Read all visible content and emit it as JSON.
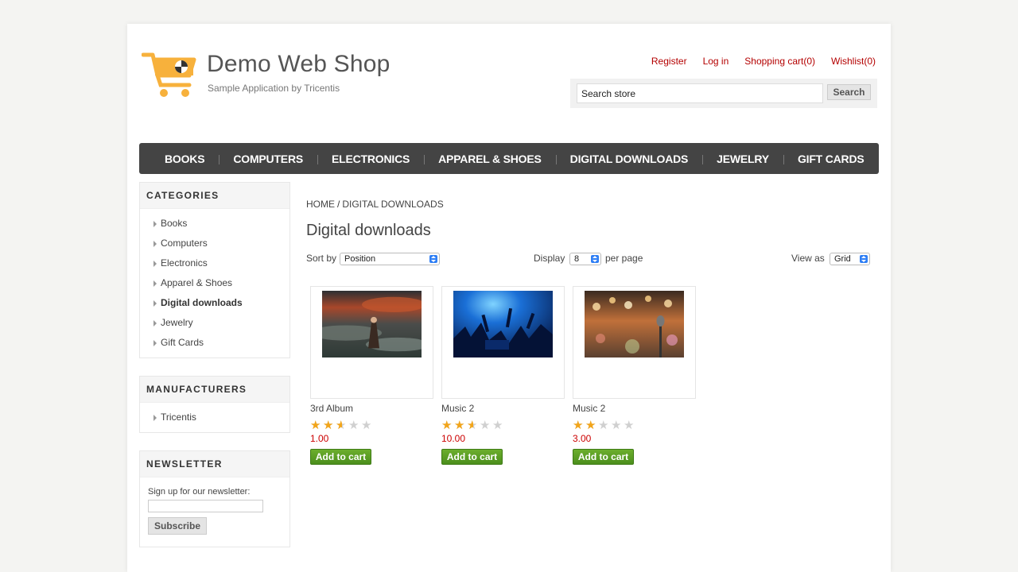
{
  "header": {
    "title": "Demo Web Shop",
    "subtitle": "Sample Application by Tricentis",
    "links": {
      "register": "Register",
      "login": "Log in",
      "cart": "Shopping cart(0)",
      "wishlist": "Wishlist(0)"
    },
    "search": {
      "value": "Search store",
      "button": "Search"
    }
  },
  "menu": [
    "BOOKS",
    "COMPUTERS",
    "ELECTRONICS",
    "APPAREL & SHOES",
    "DIGITAL DOWNLOADS",
    "JEWELRY",
    "GIFT CARDS"
  ],
  "categories": {
    "title": "CATEGORIES",
    "items": [
      "Books",
      "Computers",
      "Electronics",
      "Apparel & Shoes",
      "Digital downloads",
      "Jewelry",
      "Gift Cards"
    ],
    "active": "Digital downloads"
  },
  "manufacturers": {
    "title": "MANUFACTURERS",
    "items": [
      "Tricentis"
    ]
  },
  "newsletter": {
    "title": "NEWSLETTER",
    "label": "Sign up for our newsletter:",
    "button": "Subscribe"
  },
  "breadcrumb": {
    "home": "HOME",
    "separator": "/",
    "current": "DIGITAL DOWNLOADS"
  },
  "page_title": "Digital downloads",
  "controls": {
    "sort_label": "Sort by",
    "sort_value": "Position",
    "display_label": "Display",
    "display_value": "8",
    "per_page": "per page",
    "view_label": "View as",
    "view_value": "Grid"
  },
  "products": [
    {
      "name": "3rd Album",
      "rating": 2.5,
      "price": "1.00",
      "button": "Add to cart",
      "image": "album-cover-storm"
    },
    {
      "name": "Music 2",
      "rating": 2.5,
      "price": "10.00",
      "button": "Add to cart",
      "image": "concert-crowd-blue"
    },
    {
      "name": "Music 2",
      "rating": 2,
      "price": "3.00",
      "button": "Add to cart",
      "image": "microphone-bokeh"
    }
  ],
  "colors": {
    "accent_link": "#b40000",
    "menu_bg": "#444444",
    "price": "#cc0000",
    "cart_button": "#5a9e23",
    "star": "#f2a51a"
  }
}
